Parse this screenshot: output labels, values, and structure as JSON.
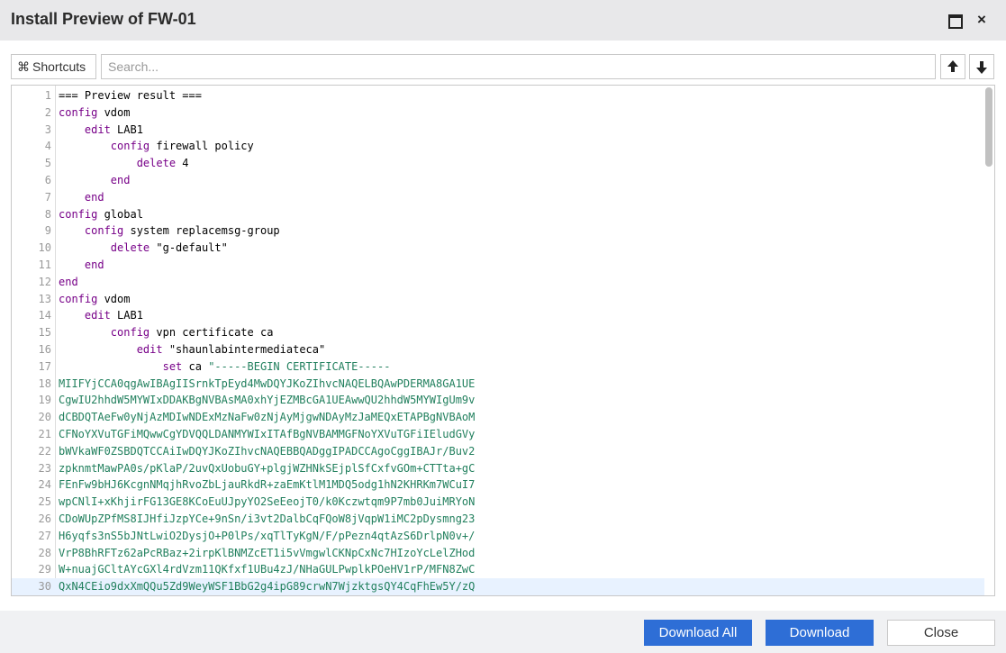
{
  "window": {
    "title": "Install Preview of FW-01",
    "maximize_icon": "maximize-icon",
    "close_label": "×"
  },
  "toolbar": {
    "shortcuts_icon": "⌘",
    "shortcuts_label": "Shortcuts",
    "search_placeholder": "Search...",
    "search_value": ""
  },
  "editor": {
    "lines": [
      [
        {
          "t": "=== Preview result ===",
          "c": ""
        }
      ],
      [
        {
          "t": "config",
          "c": "kw"
        },
        {
          "t": " vdom",
          "c": ""
        }
      ],
      [
        {
          "t": "    ",
          "c": ""
        },
        {
          "t": "edit",
          "c": "kw"
        },
        {
          "t": " LAB1",
          "c": ""
        }
      ],
      [
        {
          "t": "        ",
          "c": ""
        },
        {
          "t": "config",
          "c": "kw"
        },
        {
          "t": " firewall policy",
          "c": ""
        }
      ],
      [
        {
          "t": "            ",
          "c": ""
        },
        {
          "t": "delete",
          "c": "kw"
        },
        {
          "t": " 4",
          "c": ""
        }
      ],
      [
        {
          "t": "        ",
          "c": ""
        },
        {
          "t": "end",
          "c": "kw"
        }
      ],
      [
        {
          "t": "    ",
          "c": ""
        },
        {
          "t": "end",
          "c": "kw"
        }
      ],
      [
        {
          "t": "config",
          "c": "kw"
        },
        {
          "t": " global",
          "c": ""
        }
      ],
      [
        {
          "t": "    ",
          "c": ""
        },
        {
          "t": "config",
          "c": "kw"
        },
        {
          "t": " system replacemsg-group",
          "c": ""
        }
      ],
      [
        {
          "t": "        ",
          "c": ""
        },
        {
          "t": "delete",
          "c": "kw"
        },
        {
          "t": " \"g-default\"",
          "c": ""
        }
      ],
      [
        {
          "t": "    ",
          "c": ""
        },
        {
          "t": "end",
          "c": "kw"
        }
      ],
      [
        {
          "t": "end",
          "c": "kw"
        }
      ],
      [
        {
          "t": "config",
          "c": "kw"
        },
        {
          "t": " vdom",
          "c": ""
        }
      ],
      [
        {
          "t": "    ",
          "c": ""
        },
        {
          "t": "edit",
          "c": "kw"
        },
        {
          "t": " LAB1",
          "c": ""
        }
      ],
      [
        {
          "t": "        ",
          "c": ""
        },
        {
          "t": "config",
          "c": "kw"
        },
        {
          "t": " vpn certificate ca",
          "c": ""
        }
      ],
      [
        {
          "t": "            ",
          "c": ""
        },
        {
          "t": "edit",
          "c": "kw"
        },
        {
          "t": " \"shaunlabintermediateca\"",
          "c": ""
        }
      ],
      [
        {
          "t": "                ",
          "c": ""
        },
        {
          "t": "set",
          "c": "kw"
        },
        {
          "t": " ca ",
          "c": ""
        },
        {
          "t": "\"-----BEGIN CERTIFICATE-----",
          "c": "cert"
        }
      ],
      [
        {
          "t": "MIIFYjCCA0qgAwIBAgIISrnkTpEyd4MwDQYJKoZIhvcNAQELBQAwPDERMA8GA1UE",
          "c": "cert"
        }
      ],
      [
        {
          "t": "CgwIU2hhdW5MYWIxDDAKBgNVBAsMA0xhYjEZMBcGA1UEAwwQU2hhdW5MYWIgUm9v",
          "c": "cert"
        }
      ],
      [
        {
          "t": "dCBDQTAeFw0yNjAzMDIwNDExMzNaFw0zNjAyMjgwNDAyMzJaMEQxETAPBgNVBAoM",
          "c": "cert"
        }
      ],
      [
        {
          "t": "CFNoYXVuTGFiMQwwCgYDVQQLDANMYWIxITAfBgNVBAMMGFNoYXVuTGFiIEludGVy",
          "c": "cert"
        }
      ],
      [
        {
          "t": "bWVkaWF0ZSBDQTCCAiIwDQYJKoZIhvcNAQEBBQADggIPADCCAgoCggIBAJr/Buv2",
          "c": "cert"
        }
      ],
      [
        {
          "t": "zpknmtMawPA0s/pKlaP/2uvQxUobuGY+plgjWZHNkSEjplSfCxfvGOm+CTTta+gC",
          "c": "cert"
        }
      ],
      [
        {
          "t": "FEnFw9bHJ6KcgnNMqjhRvoZbLjauRkdR+zaEmKtlM1MDQ5odg1hN2KHRKm7WCuI7",
          "c": "cert"
        }
      ],
      [
        {
          "t": "wpCNlI+xKhjirFG13GE8KCoEuUJpyYO2SeEeojT0/k0Kczwtqm9P7mb0JuiMRYoN",
          "c": "cert"
        }
      ],
      [
        {
          "t": "CDoWUpZPfMS8IJHfiJzpYCe+9nSn/i3vt2DalbCqFQoW8jVqpW1iMC2pDysmng23",
          "c": "cert"
        }
      ],
      [
        {
          "t": "H6yqfs3nS5bJNtLwiO2DysjO+P0lPs/xqTlTyKgN/F/pPezn4qtAzS6DrlpN0v+/",
          "c": "cert"
        }
      ],
      [
        {
          "t": "VrP8BhRFTz62aPcRBaz+2irpKlBNMZcET1i5vVmgwlCKNpCxNc7HIzoYcLelZHod",
          "c": "cert"
        }
      ],
      [
        {
          "t": "W+nuajGCltAYcGXl4rdVzm11QKfxf1UBu4zJ/NHaGULPwplkPOeHV1rP/MFN8ZwC",
          "c": "cert"
        }
      ],
      [
        {
          "t": "QxN4CEio9dxXmQQu5Zd9WeyWSF1BbG2g4ipG89crwN7WjzktgsQY4CqFhEw5Y/zQ",
          "c": "cert"
        }
      ]
    ],
    "active_line": 30
  },
  "footer": {
    "download_all_label": "Download All",
    "download_label": "Download",
    "close_label": "Close"
  },
  "colors": {
    "primary": "#2e6ed6",
    "keyword": "#770088",
    "certificate": "#22805e"
  }
}
